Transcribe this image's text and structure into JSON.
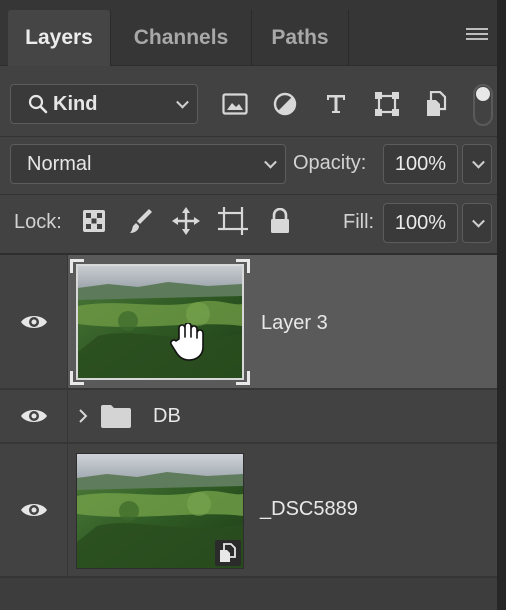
{
  "tabs": [
    {
      "label": "Layers",
      "active": true
    },
    {
      "label": "Channels",
      "active": false
    },
    {
      "label": "Paths",
      "active": false
    }
  ],
  "filter": {
    "kind_label": "Kind",
    "icons": [
      "image-filter-icon",
      "adjustment-filter-icon",
      "type-filter-icon",
      "shape-filter-icon",
      "smart-object-filter-icon"
    ]
  },
  "blend": {
    "mode": "Normal",
    "opacity_label": "Opacity:",
    "opacity_value": "100%"
  },
  "lock": {
    "label": "Lock:",
    "fill_label": "Fill:",
    "fill_value": "100%",
    "icons": [
      "lock-transparent-pixels-icon",
      "lock-image-pixels-icon",
      "lock-position-icon",
      "lock-artboard-icon",
      "lock-all-icon"
    ]
  },
  "layers": [
    {
      "name": "Layer 3",
      "type": "pixel",
      "visible": true,
      "selected": true
    },
    {
      "name": "DB",
      "type": "group",
      "visible": true,
      "selected": false,
      "expanded": false
    },
    {
      "name": "_DSC5889",
      "type": "smart-object",
      "visible": true,
      "selected": false
    }
  ],
  "colors": {
    "panel_bg": "#424242",
    "selected_row": "#5a5a5a",
    "tab_active": "#454545",
    "tab_bar": "#363636"
  }
}
